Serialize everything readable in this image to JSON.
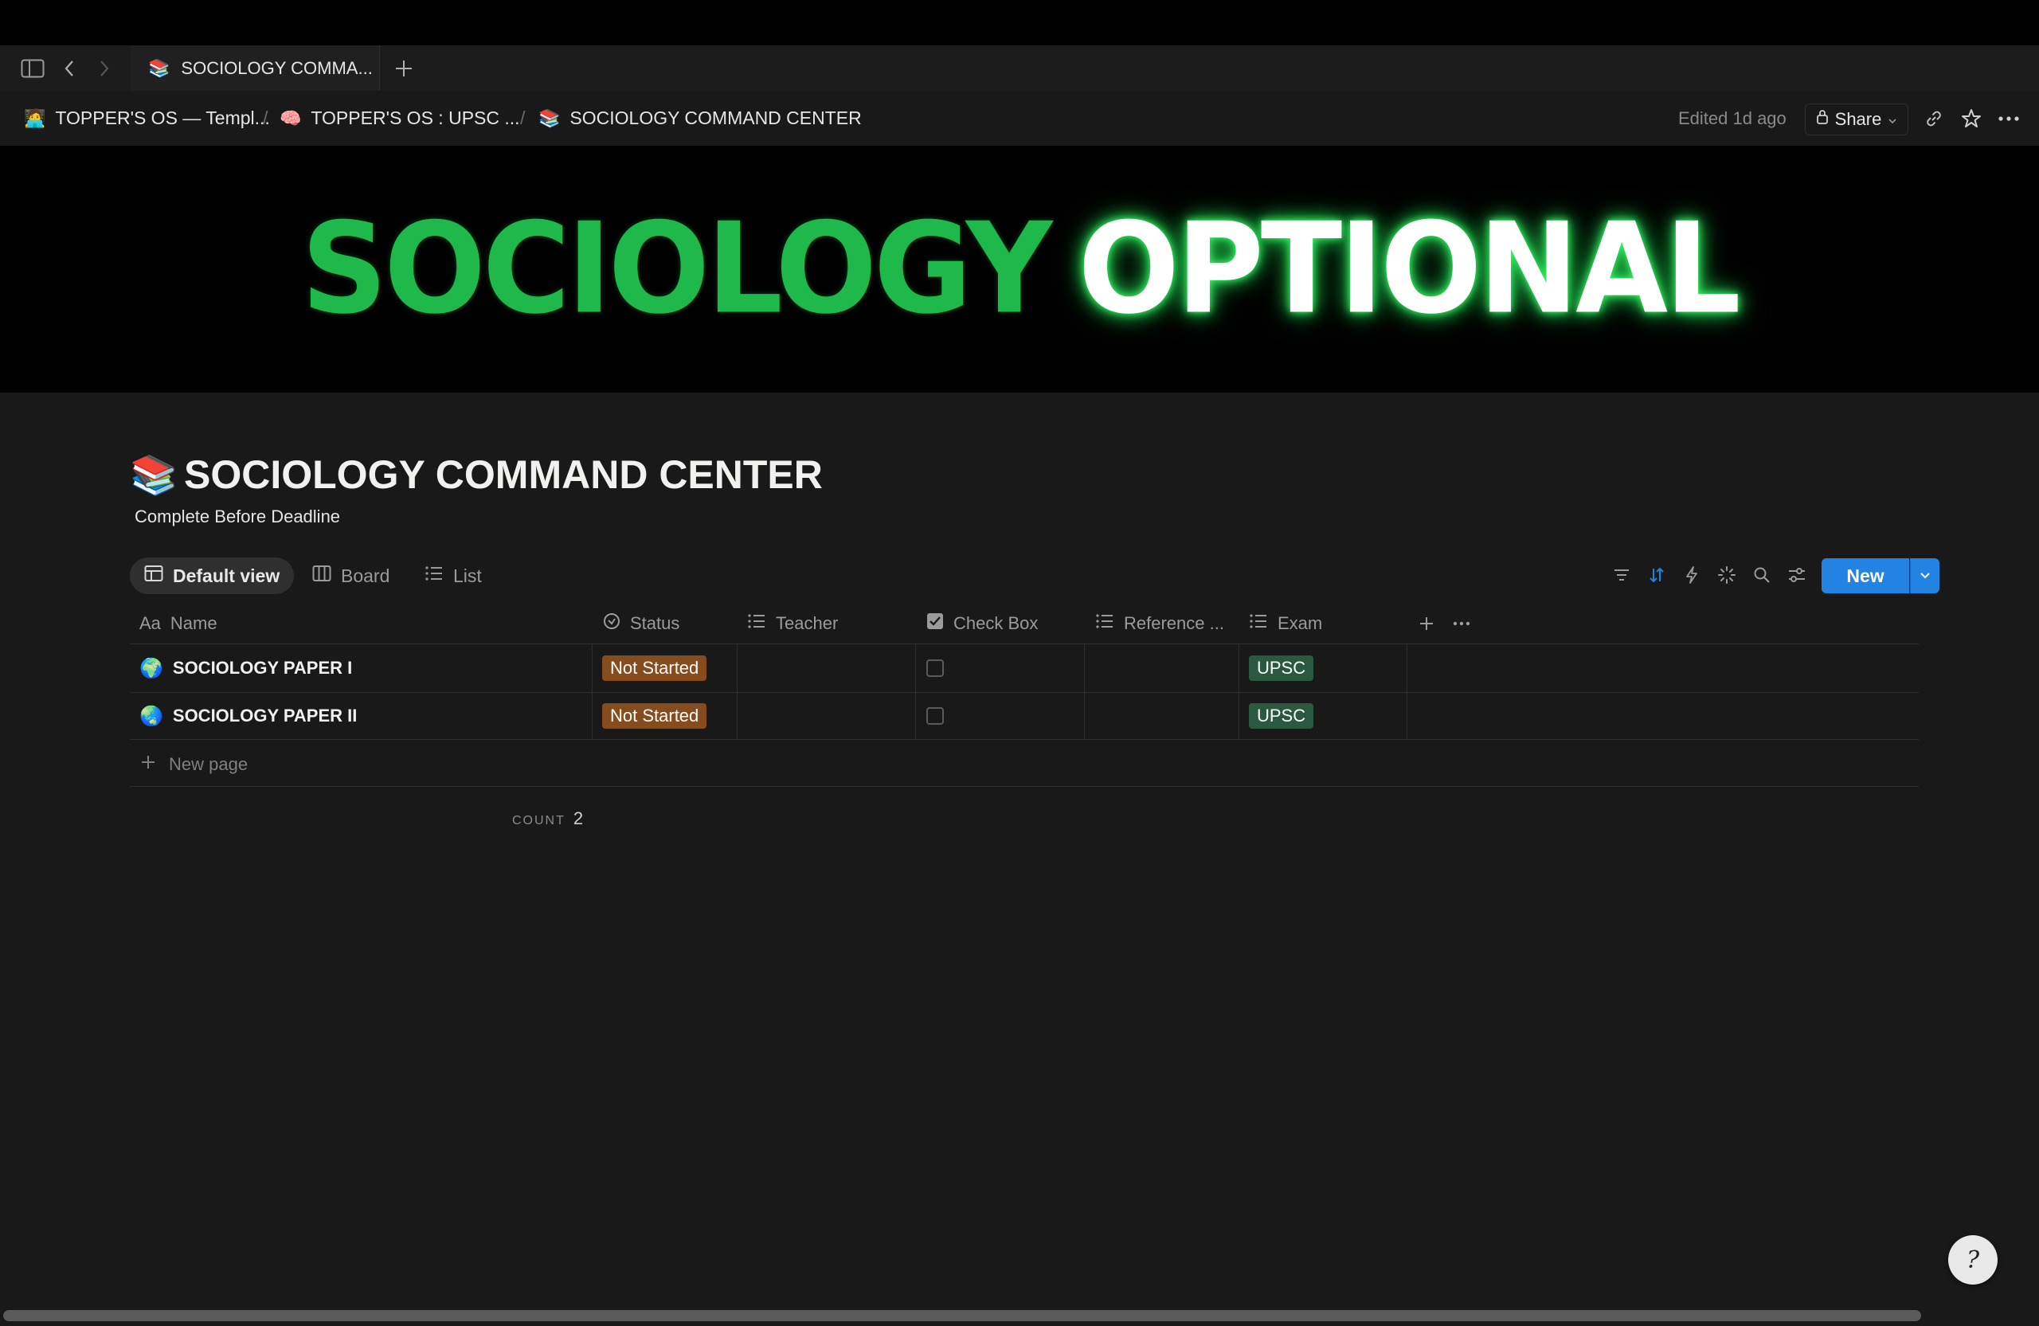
{
  "tab": {
    "emoji": "📚",
    "title": "SOCIOLOGY COMMA..."
  },
  "breadcrumb": [
    {
      "icon": "🧑‍💻",
      "label": "TOPPER'S OS — Templ..."
    },
    {
      "icon": "🧠",
      "label": "TOPPER'S OS : UPSC ..."
    },
    {
      "icon": "📚",
      "label": "SOCIOLOGY COMMAND CENTER"
    }
  ],
  "breadcrumb_separator": "/",
  "header": {
    "edited": "Edited 1d ago",
    "share_label": "Share"
  },
  "cover": {
    "word1": "SOCIOLOGY",
    "word2": "OPTIONAL"
  },
  "page": {
    "icon": "📚",
    "title": "SOCIOLOGY COMMAND CENTER",
    "description": "Complete Before Deadline"
  },
  "views": [
    {
      "label": "Default view",
      "icon": "table-icon",
      "active": true
    },
    {
      "label": "Board",
      "icon": "board-icon",
      "active": false
    },
    {
      "label": "List",
      "icon": "list-icon",
      "active": false
    }
  ],
  "toolbar": {
    "new_label": "New"
  },
  "table": {
    "columns": [
      {
        "label": "Name",
        "icon": "Aa"
      },
      {
        "label": "Status",
        "icon": "status-icon"
      },
      {
        "label": "Teacher",
        "icon": "list-icon"
      },
      {
        "label": "Check Box",
        "icon": "checkbox-icon"
      },
      {
        "label": "Reference ...",
        "icon": "list-icon"
      },
      {
        "label": "Exam",
        "icon": "list-icon"
      }
    ],
    "rows": [
      {
        "icon": "🌍",
        "name": "SOCIOLOGY PAPER I",
        "status": "Not Started",
        "teacher": "",
        "checked": false,
        "reference": "",
        "exam": "UPSC"
      },
      {
        "icon": "🌏",
        "name": "SOCIOLOGY PAPER II",
        "status": "Not Started",
        "teacher": "",
        "checked": false,
        "reference": "",
        "exam": "UPSC"
      }
    ],
    "new_page_label": "New page",
    "count_label": "COUNT",
    "count_value": "2"
  },
  "colors": {
    "accent": "#2383e2",
    "status_not_started": "#854c1d",
    "exam_tag": "#2b593f",
    "cover_green": "#1fb84a"
  }
}
